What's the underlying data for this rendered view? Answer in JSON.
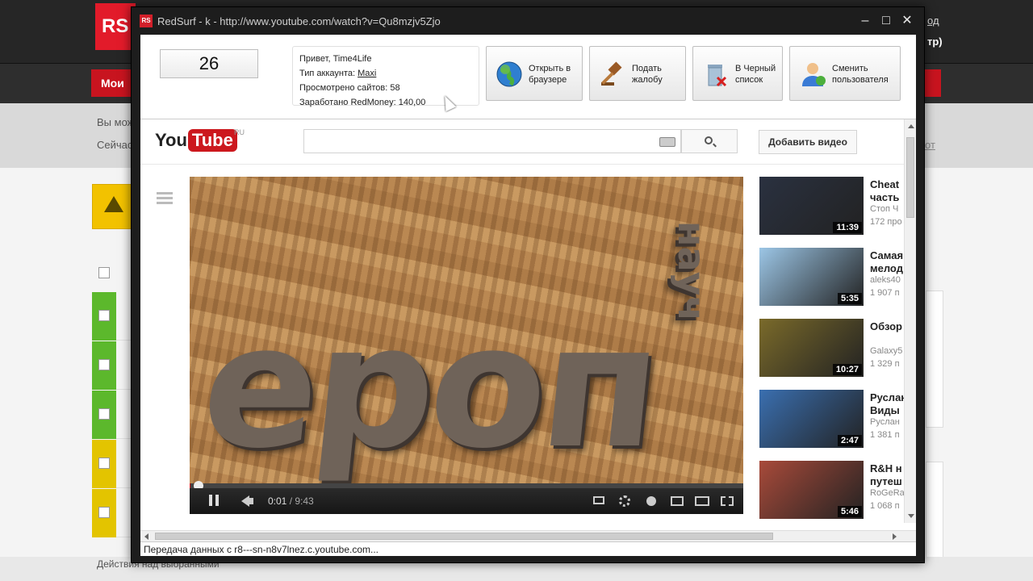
{
  "background_site": {
    "logo": "RS",
    "top_link": "од",
    "top_link2": "тр)",
    "nav_item": "Мои",
    "text1": "Вы мож",
    "text2": "Сейчас",
    "link_right": "от",
    "bottom_label": "Действия над выбранными"
  },
  "window": {
    "app_icon": "RS",
    "title": "RedSurf - k - http://www.youtube.com/watch?v=Qu8mzjv5Zjo",
    "minimize": "–",
    "maximize": "□",
    "close": "✕"
  },
  "panel": {
    "timer": "26",
    "greeting": "Привет, Time4Life",
    "account_type_label": "Тип аккаунта: ",
    "account_type_value": "Maxi",
    "sites_viewed": "Просмотрено сайтов: 58",
    "earned": "Заработано RedMoney: 140,00",
    "buttons": [
      {
        "label1": "Открыть в",
        "label2": "браузере",
        "icon": "globe-icon"
      },
      {
        "label1": "Подать",
        "label2": "жалобу",
        "icon": "gavel-icon"
      },
      {
        "label1": "В Черный",
        "label2": "список",
        "icon": "trash-icon"
      },
      {
        "label1": "Сменить",
        "label2": "пользователя",
        "icon": "user-icon"
      }
    ]
  },
  "youtube": {
    "logo_you": "You",
    "logo_tube": "Tube",
    "logo_region": "RU",
    "upload_label": "Добавить видео",
    "player": {
      "current_time": "0:01",
      "duration": " / 9:43",
      "progress_fraction": 0.002
    },
    "related": [
      {
        "title": "Cheat",
        "title2": "часть",
        "meta1": "Стоп Ч",
        "meta2": "172 про",
        "duration": "11:39",
        "thumb_color": "#2a3140"
      },
      {
        "title": "Самая",
        "title2": "мелод",
        "meta1": "aleks40",
        "meta2": "1 907 п",
        "duration": "5:35",
        "thumb_color": "#9cc6e6"
      },
      {
        "title": "Обзор",
        "title2": "",
        "meta1": "Galaxy5",
        "meta2": "1 329 п",
        "duration": "10:27",
        "thumb_color": "#7a6a2a"
      },
      {
        "title": "Руслан",
        "title2": "Виды",
        "meta1": "Руслан",
        "meta2": "1 381 п",
        "duration": "2:47",
        "thumb_color": "#3a6fb0"
      },
      {
        "title": "R&H н",
        "title2": "путеш",
        "meta1": "RoGeRa",
        "meta2": "1 068 п",
        "duration": "5:46",
        "thumb_color": "#a84a3a"
      }
    ]
  },
  "status_text": "Передача данных с r8---sn-n8v7lnez.c.youtube.com..."
}
